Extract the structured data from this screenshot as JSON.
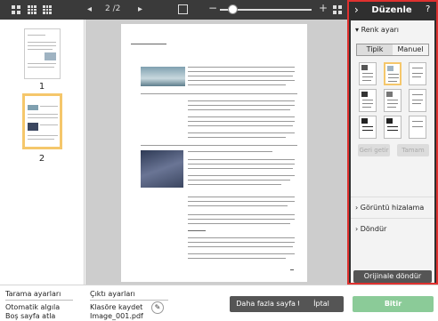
{
  "toolbar": {
    "page_indicator": "2 /2",
    "zoom_out": "−",
    "zoom_in": "+",
    "prev": "◂",
    "next": "▸",
    "zoom_percent": 0.1
  },
  "thumbnails": [
    {
      "number": "1",
      "selected": false
    },
    {
      "number": "2",
      "selected": true
    }
  ],
  "panel": {
    "title": "Düzenle",
    "back_icon": "›",
    "help_icon": "?",
    "color_section": "Renk ayarı",
    "tabs": [
      "Tipik",
      "Manuel"
    ],
    "active_tab": "Tipik",
    "disabled_buttons": [
      "Geri getir",
      "Tamam"
    ],
    "align_section": "Görüntü hizalama",
    "rotate_section": "Döndür",
    "reset_button": "Orijinale döndür",
    "accent_color": "#e0312f"
  },
  "bottom": {
    "scan_settings_label": "Tarama ayarları",
    "scan_settings_values": [
      "Otomatik algıla",
      "Boş sayfa atla"
    ],
    "output_settings_label": "Çıktı ayarları",
    "output_settings_values": [
      "Klasöre kaydet",
      "Image_001.pdf"
    ],
    "scan_more_button": "Daha fazla sayfa tara",
    "cancel_button": "İptal",
    "done_button": "Bitir"
  }
}
